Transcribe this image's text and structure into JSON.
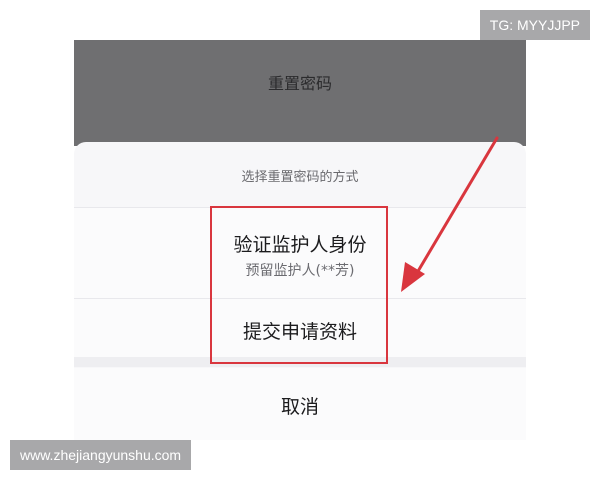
{
  "header": {
    "title": "重置密码"
  },
  "sheet": {
    "hint": "选择重置密码的方式",
    "options": [
      {
        "label": "验证监护人身份",
        "sublabel": "预留监护人(**芳)"
      },
      {
        "label": "提交申请资料"
      }
    ],
    "cancel_label": "取消"
  },
  "annotation": {
    "highlight_color": "#d9363e"
  },
  "watermarks": {
    "top_right": "TG: MYYJJPP",
    "bottom_left": "www.zhejiangyunshu.com"
  }
}
